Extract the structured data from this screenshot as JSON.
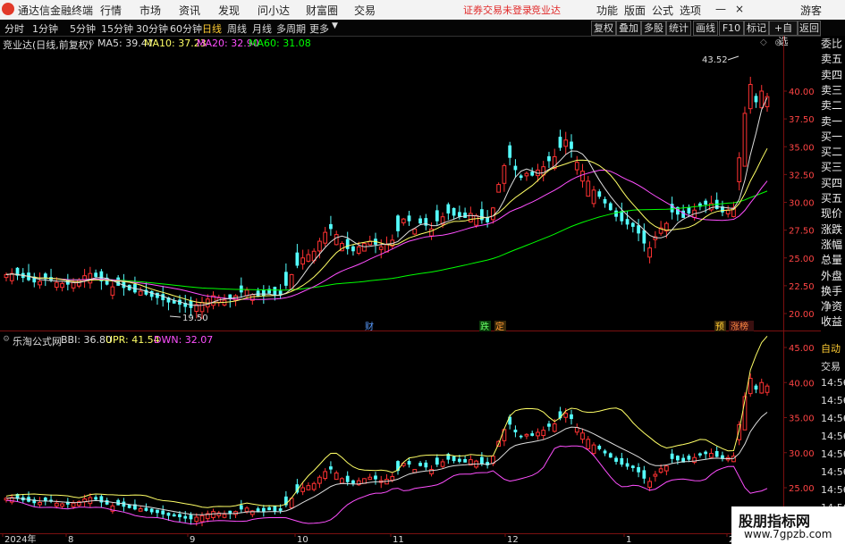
{
  "menu": {
    "app_title": "通达信金融终端",
    "items": [
      "行情",
      "市场",
      "资讯",
      "发现",
      "问小达",
      "财富圈",
      "交易"
    ],
    "warning": "证券交易未登录",
    "stock": "竞业达",
    "right": [
      "功能",
      "版面",
      "公式",
      "选项"
    ],
    "guest": "游客"
  },
  "timeframes": [
    "分时",
    "1分钟",
    "5分钟",
    "15分钟",
    "30分钟",
    "60分钟",
    "日线",
    "周线",
    "月线",
    "多周期",
    "更多"
  ],
  "toolbar_buttons": [
    "复权",
    "叠加",
    "多股",
    "统计",
    "画线",
    "F10",
    "标记",
    "+自选",
    "返回"
  ],
  "main_legend": {
    "name": "竞业达(日线,前复权)",
    "ma5": "MA5: 39.47",
    "ma10": "MA10: 37.23",
    "ma20": "MA20: 32.90",
    "ma60": "MA60: 31.08"
  },
  "main_annotations": {
    "high": "43.52",
    "low": "19.50"
  },
  "event_tags": [
    "财",
    "跌",
    "定",
    "预",
    "涨榜"
  ],
  "sub_legend": {
    "name": "乐淘公式网",
    "bbi": "BBI: 36.80",
    "upr": "UPR: 41.54",
    "dwn": "DWN: 32.07"
  },
  "x_axis": [
    "2024年",
    "8",
    "9",
    "10",
    "11",
    "12",
    "1",
    "2"
  ],
  "sidebar": [
    "委比",
    "卖五",
    "卖四",
    "卖三",
    "卖二",
    "卖一",
    "买一",
    "买二",
    "买三",
    "买四",
    "买五",
    "现价",
    "涨跌",
    "涨幅",
    "总量",
    "外盘",
    "换手",
    "净资",
    "收益"
  ],
  "sidebar2": [
    "自动",
    "交易",
    "14:56",
    "14:56",
    "14:56",
    "14:56",
    "14:56",
    "14:56",
    "14:56",
    "14:56"
  ],
  "watermark": {
    "title": "股朋指标网",
    "url": "www.7gpzb.com"
  },
  "colors": {
    "up": "#ff3232",
    "down": "#54ffff",
    "ma5": "#ffff66",
    "ma10": "#ff4fff",
    "ma20": "#00ff00",
    "ma60": "#dddddd",
    "bg": "#000000"
  },
  "chart_data": [
    {
      "type": "candlestick",
      "title": "竞业达(日线,前复权)",
      "ylim": [
        19,
        44
      ],
      "y_ticks": [
        "40.00",
        "37.50",
        "35.00",
        "32.50",
        "30.00",
        "27.50",
        "25.00",
        "22.50",
        "20.00"
      ],
      "trend_closes": [
        23.5,
        23.6,
        23.4,
        23.2,
        23.0,
        22.8,
        22.9,
        23.1,
        23.0,
        22.8,
        22.7,
        22.6,
        22.8,
        23.0,
        23.4,
        23.6,
        23.3,
        22.9,
        22.6,
        22.4,
        22.5,
        22.3,
        22.1,
        21.9,
        22.0,
        21.7,
        21.5,
        21.4,
        21.2,
        21.0,
        20.9,
        20.8,
        20.6,
        20.5,
        20.8,
        21.0,
        21.3,
        21.6,
        21.4,
        21.2,
        21.3,
        21.6,
        21.9,
        22.1,
        21.7,
        21.5,
        21.6,
        21.8,
        21.6,
        21.7,
        22.5,
        23.5,
        24.3,
        25.0,
        25.3,
        25.6,
        26.5,
        27.3,
        27.6,
        27.1,
        26.3,
        25.8,
        25.6,
        26.0,
        26.3,
        26.5,
        26.2,
        26.0,
        26.2,
        26.6,
        27.4,
        28.5,
        28.3,
        27.6,
        28.1,
        27.9,
        27.6,
        28.3,
        28.7,
        29.0,
        28.8,
        28.7,
        28.6,
        29.0,
        28.8,
        28.4,
        28.2,
        29.5,
        31.6,
        33.3,
        34.0,
        32.9,
        32.2,
        32.6,
        32.4,
        32.9,
        33.2,
        33.7,
        34.1,
        34.9,
        35.6,
        34.8,
        33.6,
        32.8,
        31.9,
        31.1,
        30.5,
        29.9,
        29.3,
        28.7,
        28.3,
        28.0,
        27.8,
        27.2,
        26.3,
        25.9,
        26.9,
        27.7,
        28.1,
        29.1,
        28.9,
        28.6,
        29.0,
        29.3,
        29.6,
        29.8,
        29.9,
        29.4,
        29.1,
        29.3,
        29.5,
        34.0,
        38.0,
        40.6,
        39.0,
        40.0,
        39.5
      ]
    },
    {
      "type": "candlestick",
      "title": "乐淘公式网",
      "ylim": [
        22.5,
        46
      ],
      "y_ticks": [
        "45.00",
        "40.00",
        "35.00",
        "30.00",
        "25.00"
      ],
      "series": [
        {
          "name": "BBI"
        },
        {
          "name": "UPR"
        },
        {
          "name": "DWN"
        }
      ]
    }
  ]
}
